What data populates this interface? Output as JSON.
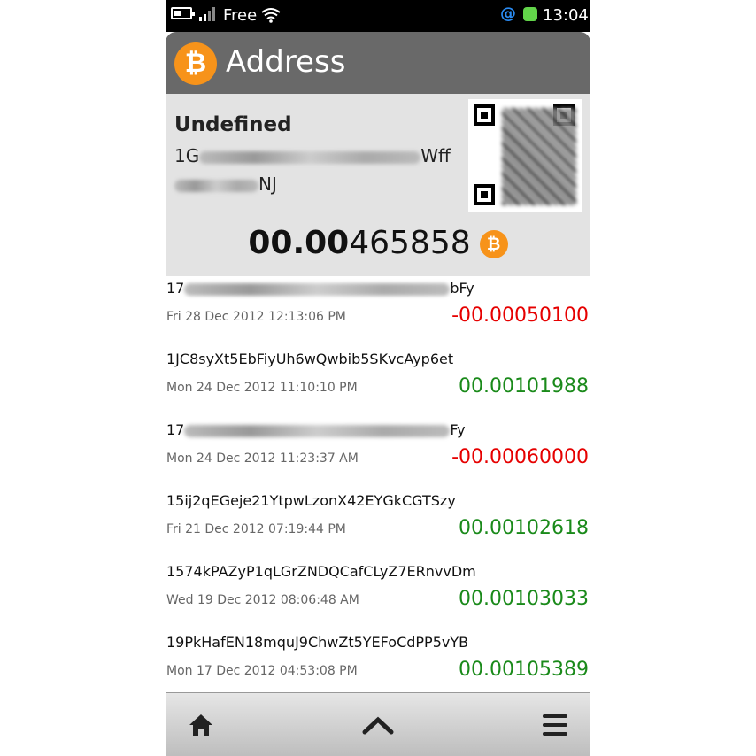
{
  "status_bar": {
    "carrier": "Free",
    "time": "13:04",
    "icons": [
      "battery-icon",
      "signal-icon",
      "wifi-icon",
      "at-icon",
      "status-dot-icon"
    ]
  },
  "header": {
    "logo_symbol": "₿",
    "title": "Address"
  },
  "address": {
    "label": "Undefined",
    "line1_start": "1G",
    "line1_end": "Wff",
    "line2_end": "NJ",
    "balance_bold": "00.00",
    "balance_rest": "465858",
    "coin_symbol": "₿"
  },
  "transactions": [
    {
      "addr_start": "17",
      "addr_end": "bFy",
      "date": "Fri 28 Dec 2012 12:13:06 PM",
      "amount": "-00.00050100",
      "type": "out"
    },
    {
      "addr_start": "1JC8syXt5EbFiyUh6wQwbib5SKvcAyp6et",
      "addr_end": "",
      "date": "Mon 24 Dec 2012 11:10:10 PM",
      "amount": "00.00101988",
      "type": "in"
    },
    {
      "addr_start": "17",
      "addr_end": "Fy",
      "date": "Mon 24 Dec 2012 11:23:37 AM",
      "amount": "-00.00060000",
      "type": "out"
    },
    {
      "addr_start": "15ij2qEGeje21YtpwLzonX42EYGkCGTSzy",
      "addr_end": "",
      "date": "Fri 21 Dec 2012 07:19:44 PM",
      "amount": "00.00102618",
      "type": "in"
    },
    {
      "addr_start": "1574kPAZyP1qLGrZNDQCafCLyZ7ERnvvDm",
      "addr_end": "",
      "date": "Wed 19 Dec 2012 08:06:48 AM",
      "amount": "00.00103033",
      "type": "in"
    },
    {
      "addr_start": "19PkHafEN18mquJ9ChwZt5YEFoCdPP5vYB",
      "addr_end": "",
      "date": "Mon 17 Dec 2012 04:53:08 PM",
      "amount": "00.00105389",
      "type": "in"
    }
  ],
  "toolbar": {
    "home_icon": "home-icon",
    "up_icon": "chevron-up-icon",
    "menu_icon": "menu-icon"
  },
  "colors": {
    "accent_bitcoin": "#f7931a",
    "negative": "#e60000",
    "positive": "#1a8a1a",
    "titlebar": "#696969"
  }
}
